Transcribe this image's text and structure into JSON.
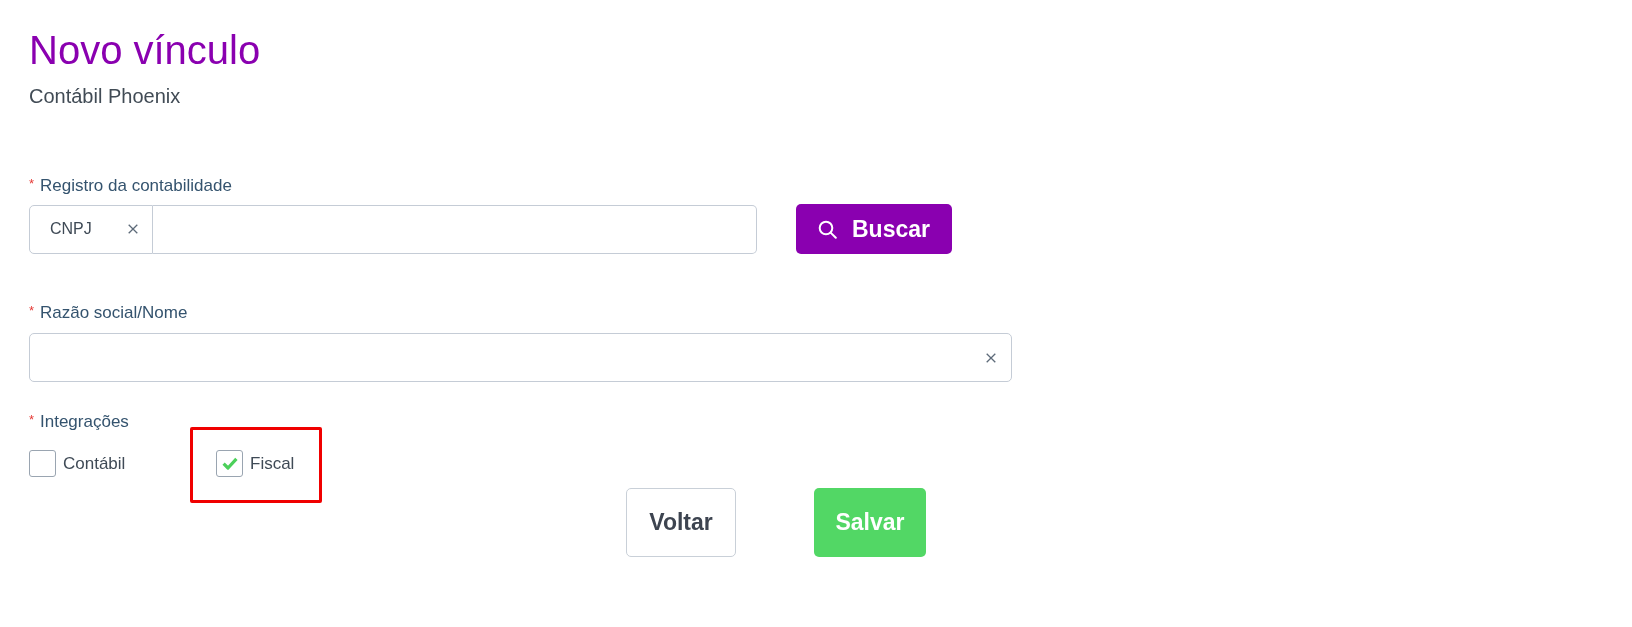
{
  "header": {
    "title": "Novo vínculo",
    "subtitle": "Contábil Phoenix"
  },
  "registro": {
    "required_mark": "*",
    "label": "Registro da contabilidade",
    "document_type": "CNPJ",
    "search_button": "Buscar"
  },
  "razao_social": {
    "required_mark": "*",
    "label": "Razão social/Nome"
  },
  "integracoes": {
    "required_mark": "*",
    "label": "Integrações",
    "options": [
      {
        "label": "Contábil",
        "checked": false,
        "highlighted": false
      },
      {
        "label": "Fiscal",
        "checked": true,
        "highlighted": true
      }
    ]
  },
  "buttons": [
    {
      "kind": "secondary",
      "label": "Voltar"
    },
    {
      "kind": "primary",
      "label": "Salvar"
    }
  ]
}
